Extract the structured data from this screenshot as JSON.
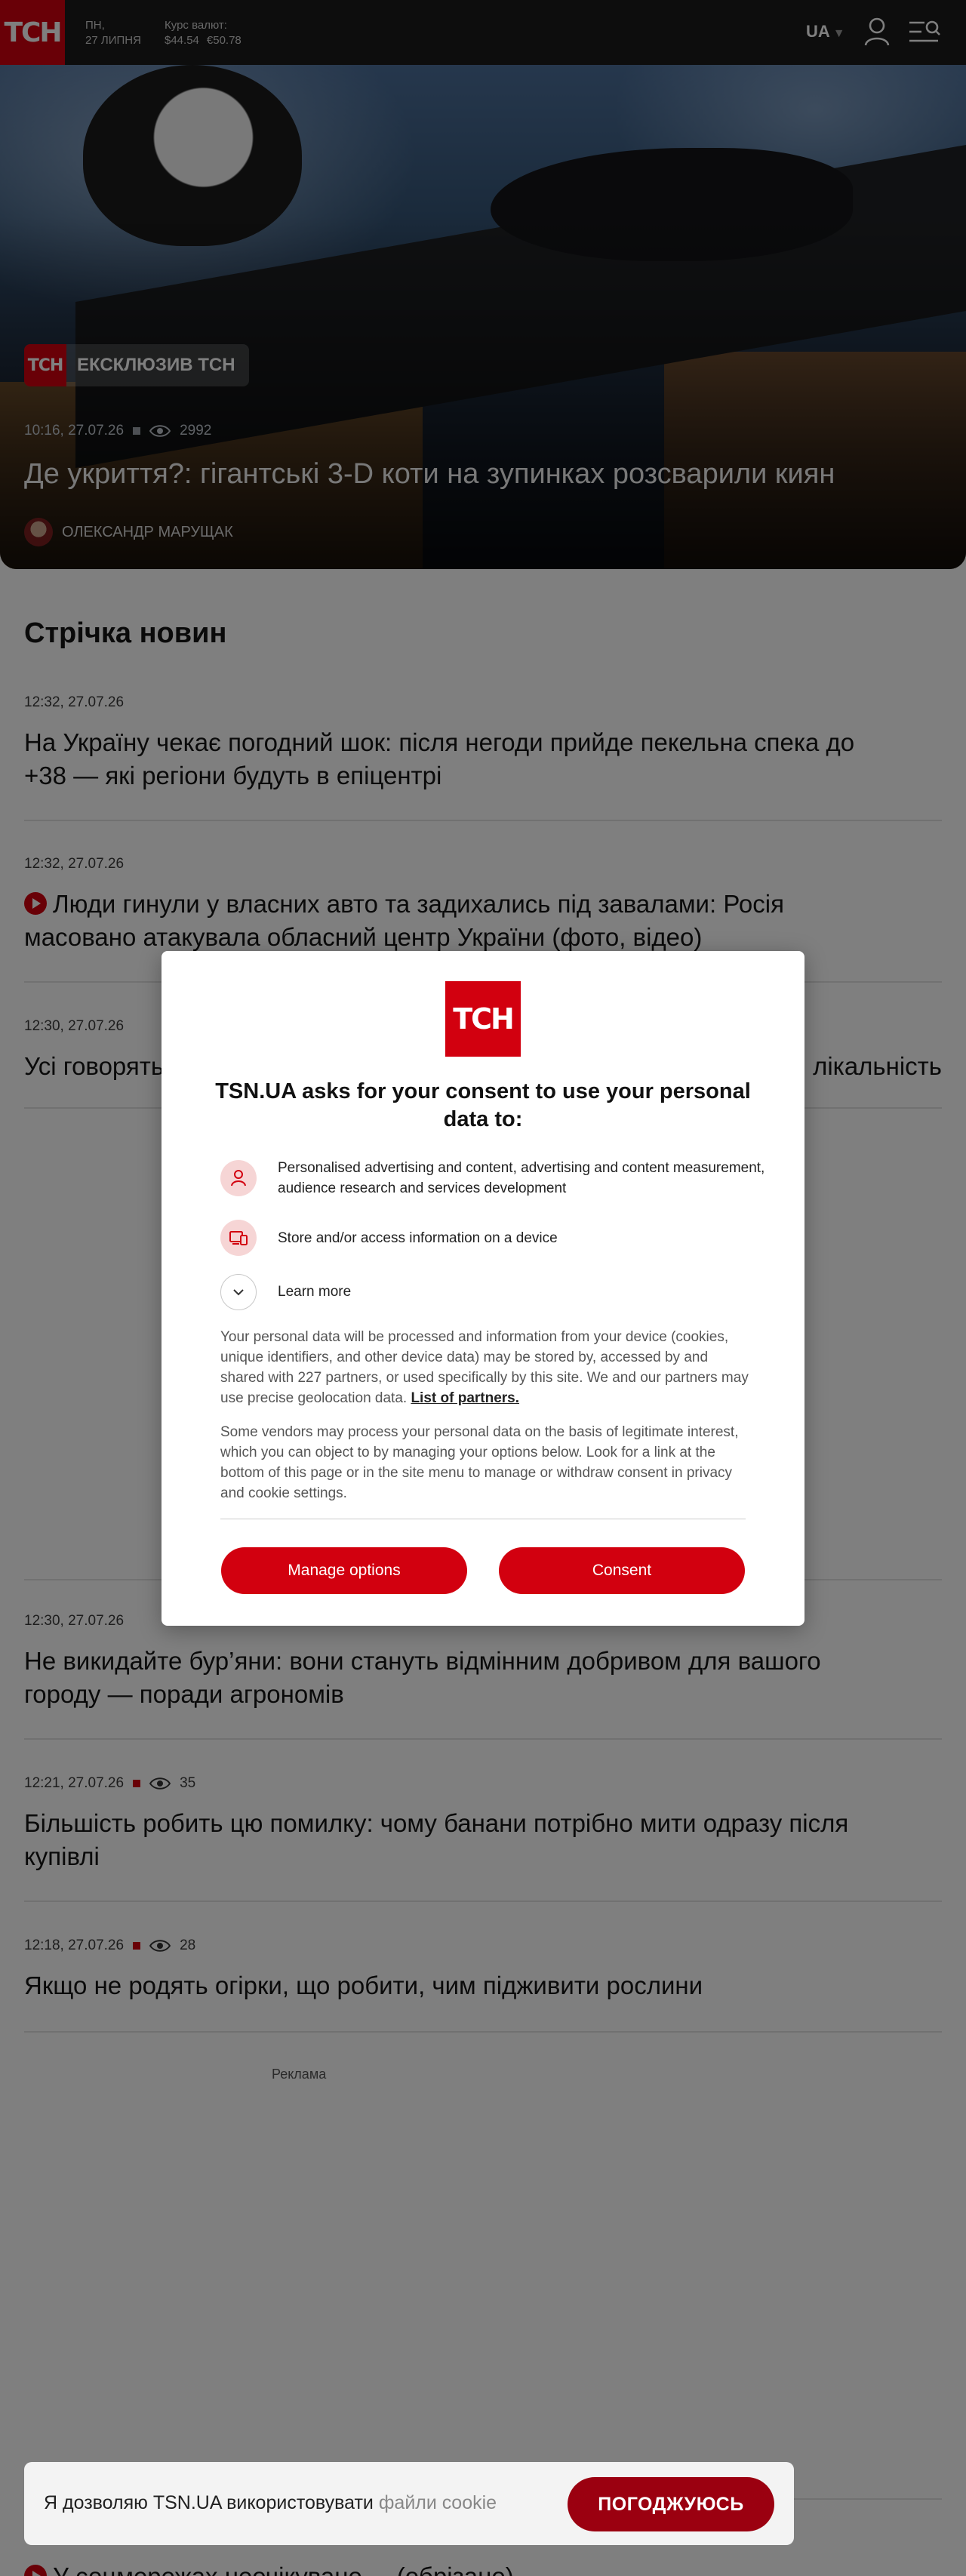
{
  "header": {
    "logo": "ТСН",
    "day": "ПН,",
    "date": "27 ЛИПНЯ",
    "rates_label": "Курс валют:",
    "usd": "$44.54",
    "eur": "€50.78",
    "language": "UA"
  },
  "hero": {
    "badge_logo": "ТСН",
    "badge_text": "ЕКСКЛЮЗИВ ТСН",
    "time": "10:16, 27.07.26",
    "views": "2992",
    "title": "Де укриття?: гігантські 3-D коти на зупинках розсварили киян",
    "author": "ОЛЕКСАНДР МАРУЩАК"
  },
  "feed": {
    "title": "Стрічка новин",
    "items": [
      {
        "time": "12:32, 27.07.26",
        "title": "На Україну чекає погодний шок: після негоди прийде пекельна спека до +38 — які регіони будуть в епіцентрі"
      },
      {
        "time": "12:32, 27.07.26",
        "title": "Люди гинули у власних авто та задихались під завалами: Росія масовано атакувала обласний центр України (фото, відео)"
      },
      {
        "time": "12:30, 27.07.26",
        "title_left": "Усі говорять",
        "title_right": "лікальність"
      },
      {
        "time": "12:30, 27.07.26",
        "title": "Не викидайте бур’яни: вони стануть відмінним добривом для вашого городу — поради агрономів"
      },
      {
        "time": "12:21, 27.07.26",
        "views": "35",
        "title": "Більшість робить цю помилку: чому банани потрібно мити одразу після купівлі"
      },
      {
        "time": "12:18, 27.07.26",
        "views": "28",
        "title": "Якщо не родять огірки, що робити, чим підживити рослини"
      }
    ],
    "ad_label": "Реклама",
    "last_title": "У соцмережах неочікувано ... (обрізано)"
  },
  "consent": {
    "logo": "ТСН",
    "title": "TSN.UA asks for your consent to use your personal data to:",
    "purpose_1": "Personalised advertising and content, advertising and content measurement, audience research and services development",
    "purpose_2": "Store and/or access information on a device",
    "learn_more": "Learn more",
    "para_1": "Your personal data will be processed and information from your device (cookies, unique identifiers, and other device data) may be stored by, accessed by and shared with 227 partners, or used specifically by this site. We and our partners may use precise geolocation data.",
    "partners_link": "List of partners.",
    "para_2": "Some vendors may process your personal data on the basis of legitimate interest, which you can object to by managing your options below. Look for a link at the bottom of this page or in the site menu to manage or withdraw consent in privacy and cookie settings.",
    "manage_button": "Manage options",
    "consent_button": "Consent"
  },
  "cookie_bar": {
    "text": "Я дозволяю TSN.UA використовувати",
    "muted": "файли cookie",
    "button": "ПОГОДЖУЮСЬ"
  },
  "colors": {
    "brand": "#d2000f",
    "header_bg": "#1a1a1a"
  }
}
